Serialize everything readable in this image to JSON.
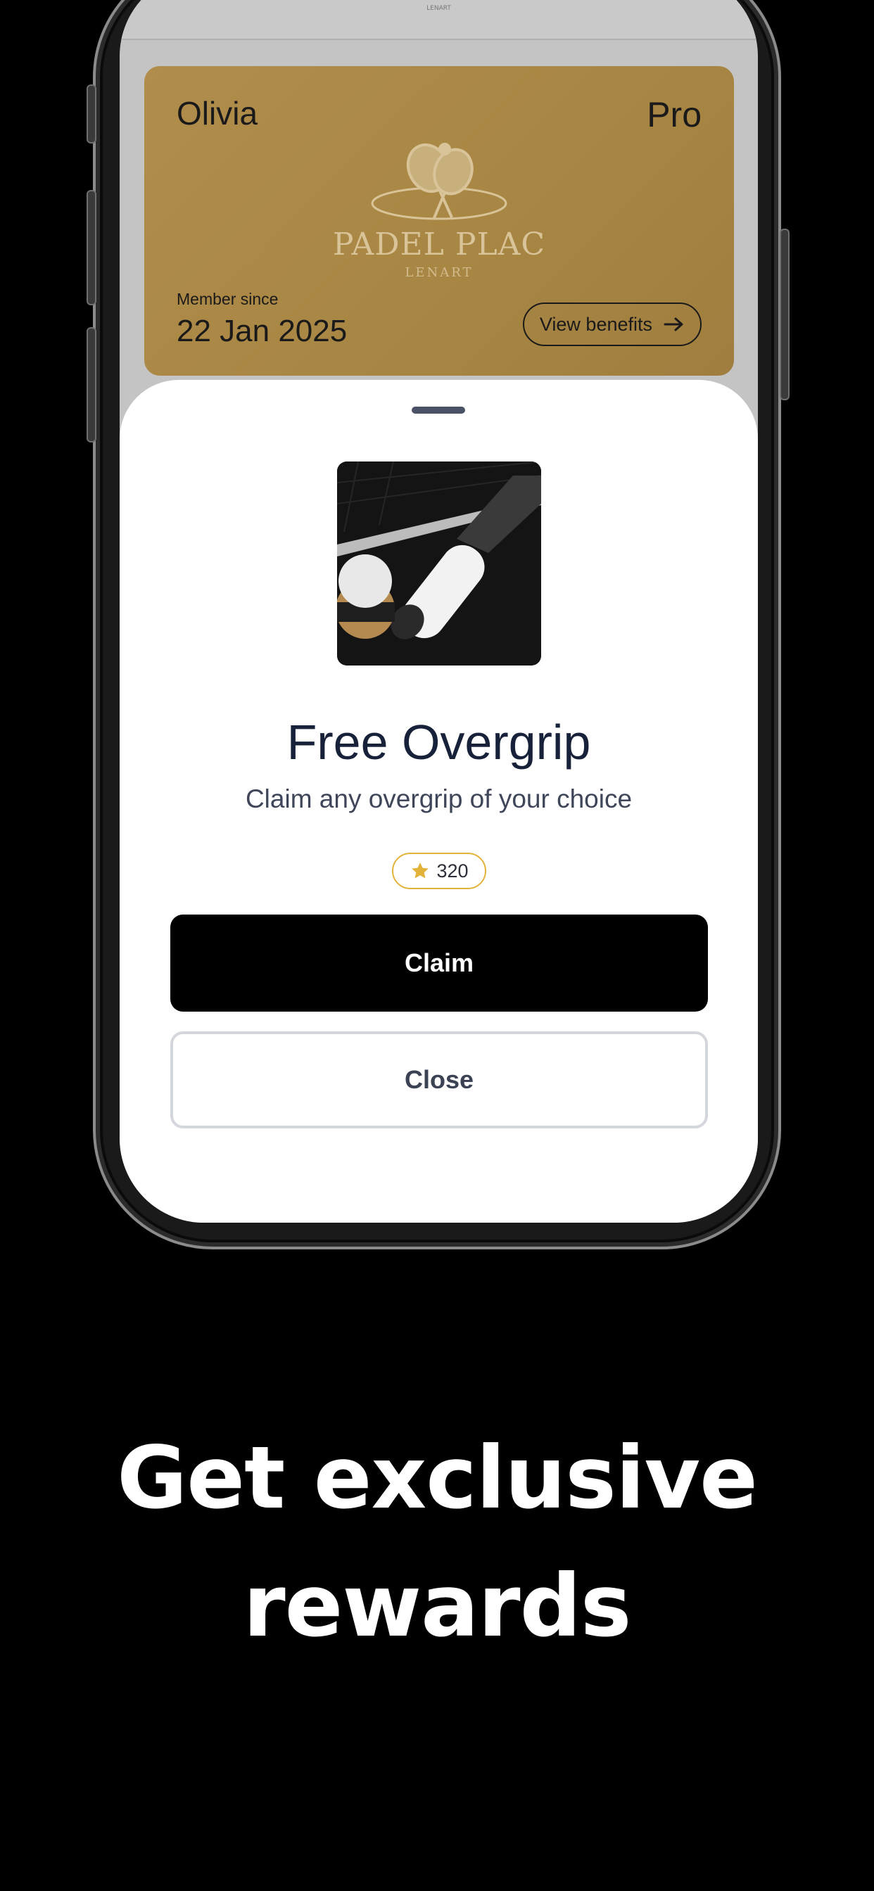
{
  "card": {
    "name": "Olivia",
    "tier": "Pro",
    "logo_text": "PADEL PLAC",
    "logo_sub": "LENART",
    "member_since_label": "Member since",
    "member_since_date": "22 Jan 2025",
    "benefits_label": "View benefits"
  },
  "top_strip": {
    "text": "LENART"
  },
  "reward": {
    "title": "Free Overgrip",
    "description": "Claim any overgrip of your choice",
    "points": "320",
    "points_icon": "star-icon",
    "image_alt": "padel racket with overgrip"
  },
  "actions": {
    "claim_label": "Claim",
    "close_label": "Close"
  },
  "tagline": {
    "line1": "Get exclusive",
    "line2": "rewards"
  },
  "colors": {
    "card_gold": "#a88643",
    "accent_star": "#e3b23a",
    "title_navy": "#18213a"
  }
}
